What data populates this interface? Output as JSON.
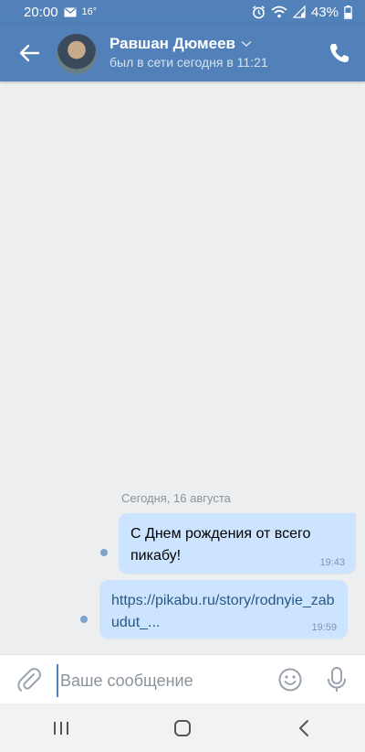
{
  "status_bar": {
    "time": "20:00",
    "temperature": "16°",
    "battery": "43%",
    "icons": [
      "mail-icon",
      "alarm-icon",
      "wifi-icon",
      "signal-icon",
      "battery-icon"
    ]
  },
  "header": {
    "contact_name": "Равшан Дюмеев",
    "contact_status": "был в сети сегодня в 11:21",
    "icons": [
      "back-arrow-icon",
      "chevron-down-icon",
      "phone-icon"
    ]
  },
  "chat": {
    "date_separator": "Сегодня, 16 августа",
    "messages": [
      {
        "text": "С Днем рождения от всего пикабу!",
        "time": "19:43",
        "outgoing": true,
        "unread": true
      },
      {
        "text": "https://pikabu.ru/story/rodnyie_zabudut_...",
        "time": "19:59",
        "outgoing": true,
        "unread": true,
        "is_link": true
      }
    ]
  },
  "composer": {
    "placeholder": "Ваше сообщение",
    "value": "",
    "icons": [
      "paperclip-icon",
      "emoji-icon",
      "microphone-icon"
    ]
  },
  "nav_bar": {
    "icons": [
      "recent-apps-icon",
      "home-icon",
      "back-icon"
    ]
  },
  "colors": {
    "accent": "#5181b8",
    "background": "#edeef0",
    "bubble": "#cce4ff",
    "link": "#2a5885"
  }
}
